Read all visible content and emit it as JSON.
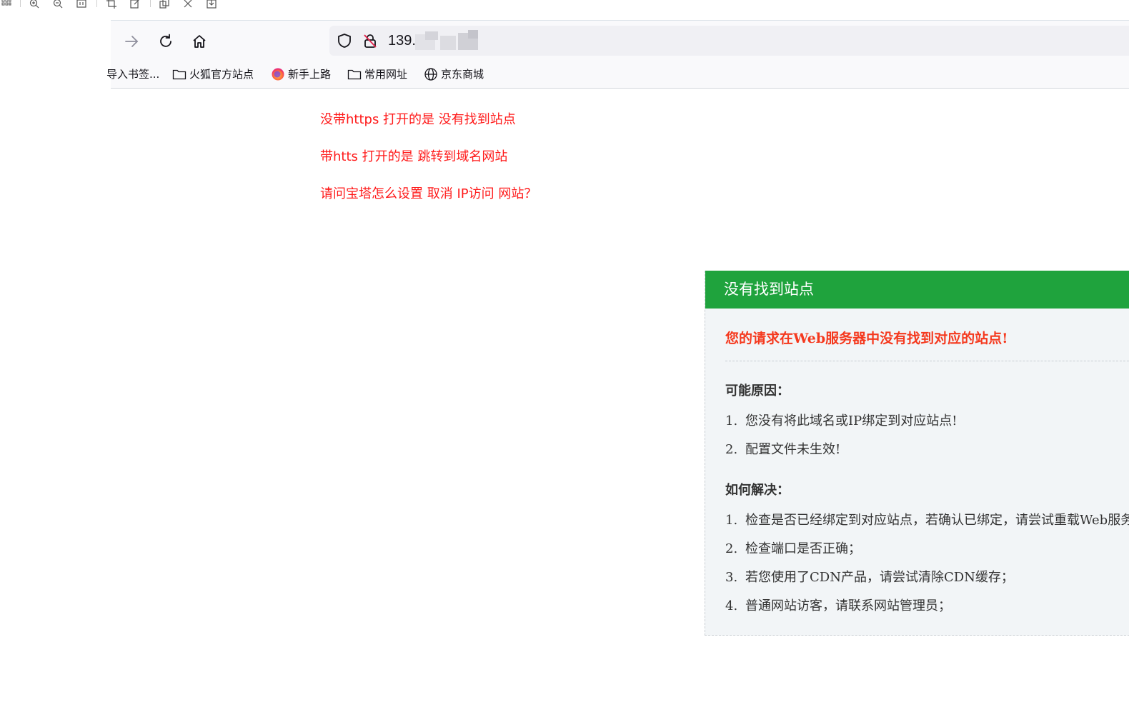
{
  "browser": {
    "url_visible": "139.",
    "bookmarks": [
      "导入书签...",
      "火狐官方站点",
      "新手上路",
      "常用网址",
      "京东商城"
    ]
  },
  "question": {
    "lines": [
      "没带https 打开的是 没有找到站点",
      "带htts 打开的是 跳转到域名网站",
      "请问宝塔怎么设置 取消 IP访问 网站？"
    ]
  },
  "error_page": {
    "header": "没有找到站点",
    "main_message": "您的请求在Web服务器中没有找到对应的站点!",
    "reasons_title": "可能原因：",
    "reasons": [
      {
        "num": "1.",
        "text": "您没有将此域名或IP绑定到对应站点!"
      },
      {
        "num": "2.",
        "text": "配置文件未生效!"
      }
    ],
    "solutions_title": "如何解决：",
    "solutions": [
      {
        "num": "1.",
        "text": "检查是否已经绑定到对应站点，若确认已绑定，请尝试重载Web服务"
      },
      {
        "num": "2.",
        "text": "检查端口是否正确；"
      },
      {
        "num": "3.",
        "text": "若您使用了CDN产品，请尝试清除CDN缓存；"
      },
      {
        "num": "4.",
        "text": "普通网站访客，请联系网站管理员；"
      }
    ]
  },
  "colors": {
    "question_text": "#ff1a1a",
    "header_green": "#1fa33d",
    "error_red": "#f5391e"
  }
}
